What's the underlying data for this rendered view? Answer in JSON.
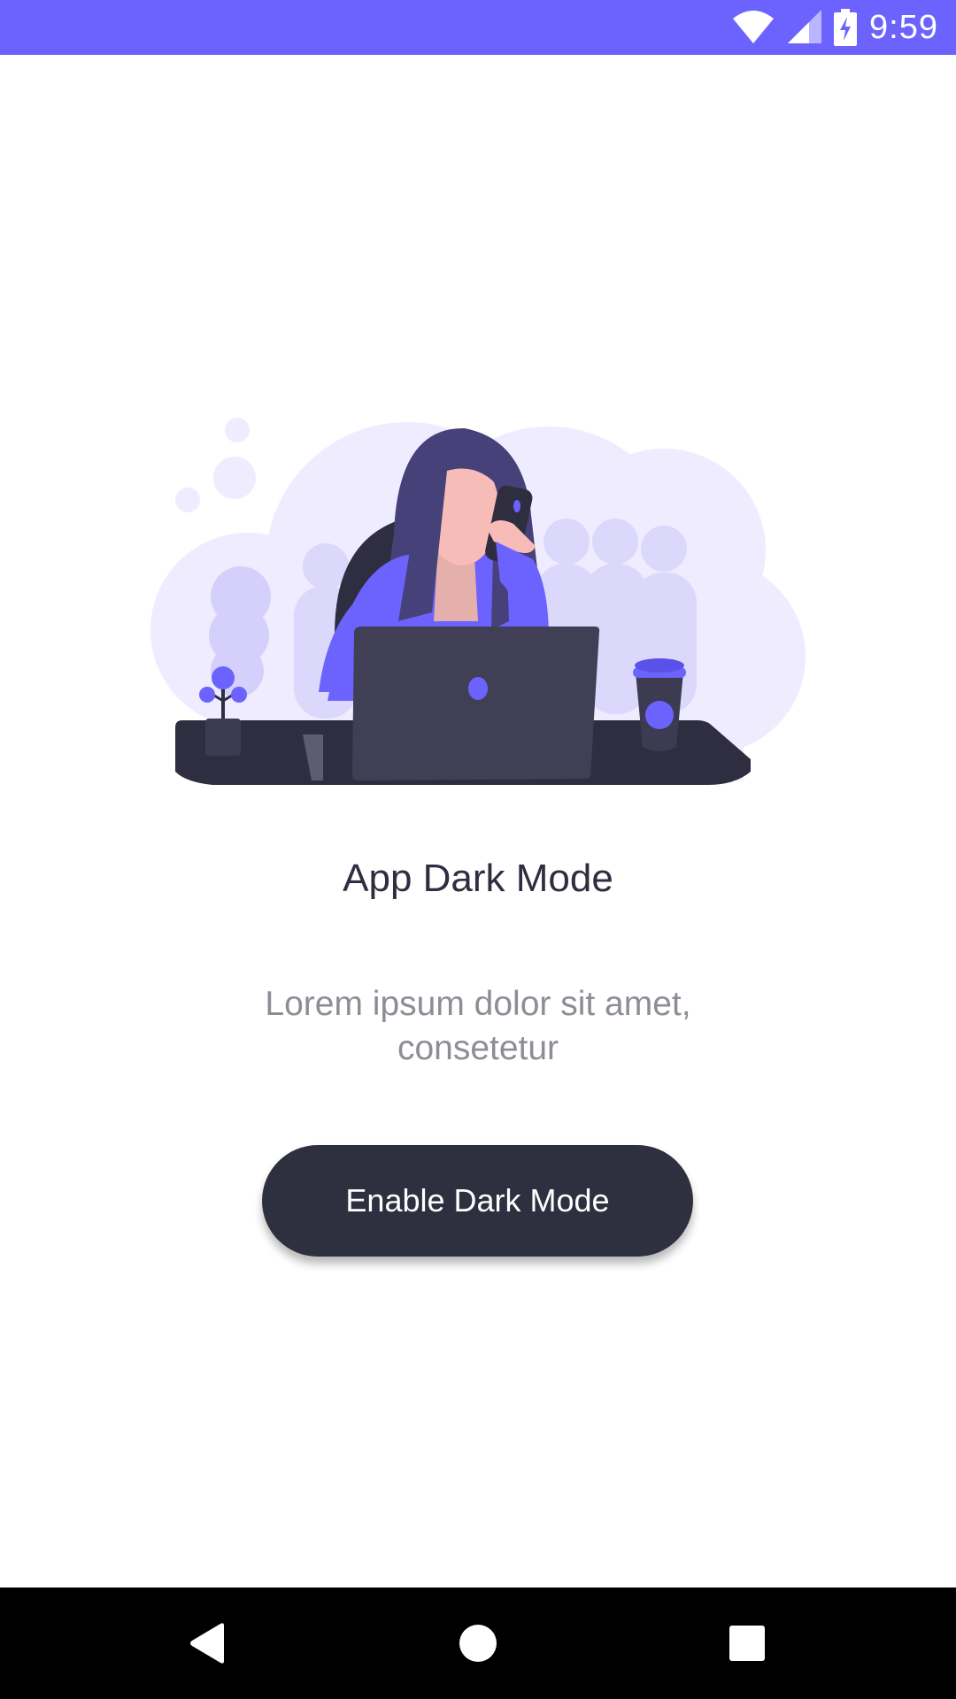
{
  "status_bar": {
    "time": "9:59",
    "icons": [
      "wifi-icon",
      "cell-signal-icon",
      "battery-charging-icon"
    ],
    "background": "#6c63ff"
  },
  "illustration": {
    "name": "woman-working-on-laptop-illustration",
    "accent": "#6c63ff",
    "dark": "#2f2e41"
  },
  "content": {
    "title": "App Dark Mode",
    "subtitle": "Lorem ipsum dolor sit amet, consetetur",
    "button_label": "Enable Dark Mode"
  },
  "navigation_bar": {
    "buttons": [
      "back-icon",
      "home-icon",
      "recents-icon"
    ]
  }
}
